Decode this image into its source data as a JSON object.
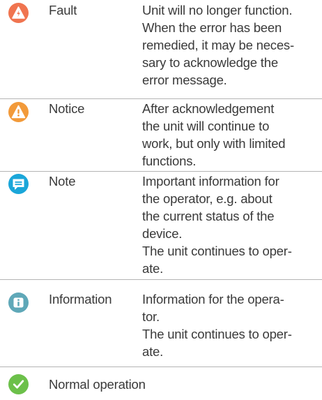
{
  "colors": {
    "fault": "#f0744f",
    "notice": "#f29a3a",
    "note": "#1aa6d9",
    "information": "#5fa8b8",
    "normal": "#6cc04a",
    "divider": "#b4b4b4",
    "text": "#3a3a3a"
  },
  "rows": [
    {
      "icon": "fault-icon",
      "label": "Fault",
      "lines": [
        "Unit will no longer function.",
        "When the error has been",
        "remedied, it may be neces-",
        "sary to acknowledge the",
        "error message."
      ]
    },
    {
      "icon": "notice-warning-icon",
      "label": "Notice",
      "lines": [
        "After acknowledgement",
        "the unit will continue to",
        "work, but only with limited",
        "functions."
      ]
    },
    {
      "icon": "note-speech-bubble-icon",
      "label": "Note",
      "lines": [
        "Important information for",
        "the operator, e.g. about",
        "the current status of the",
        "device.",
        "The unit continues to oper-",
        "ate."
      ]
    },
    {
      "icon": "information-icon",
      "label": "Information",
      "lines": [
        "Information for the opera-",
        "tor.",
        "The unit continues to oper-",
        "ate."
      ]
    },
    {
      "icon": "checkmark-icon",
      "label": "Normal operation",
      "lines": []
    }
  ]
}
